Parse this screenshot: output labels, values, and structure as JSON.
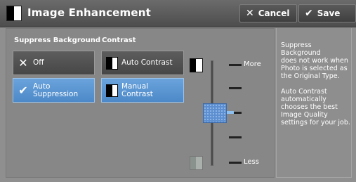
{
  "header": {
    "title": "Image Enhancement",
    "cancel_label": "Cancel",
    "save_label": "Save"
  },
  "suppress_background": {
    "label": "Suppress Background",
    "options": [
      {
        "label": "Off",
        "icon": "x-icon",
        "selected": false
      },
      {
        "label": "Auto\nSuppression",
        "icon": "check-icon",
        "selected": true
      }
    ]
  },
  "contrast": {
    "label": "Contrast",
    "options": [
      {
        "label": "Auto Contrast",
        "icon": "auto-contrast-icon",
        "selected": false
      },
      {
        "label": "Manual\nContrast",
        "icon": "manual-contrast-icon",
        "selected": true
      }
    ],
    "slider": {
      "top_label": "More",
      "bottom_label": "Less",
      "level": 0.5
    }
  },
  "info": {
    "text": "Suppress\nBackground\ndoes not work when\nPhoto is selected as\nthe Original Type.\n\nAuto Contrast\nautomatically\nchooses the best\nImage Quality\nsettings for your job."
  },
  "colors": {
    "selected": "#5b97d4",
    "unselected": "#4f4f4f",
    "header": "#555555"
  }
}
